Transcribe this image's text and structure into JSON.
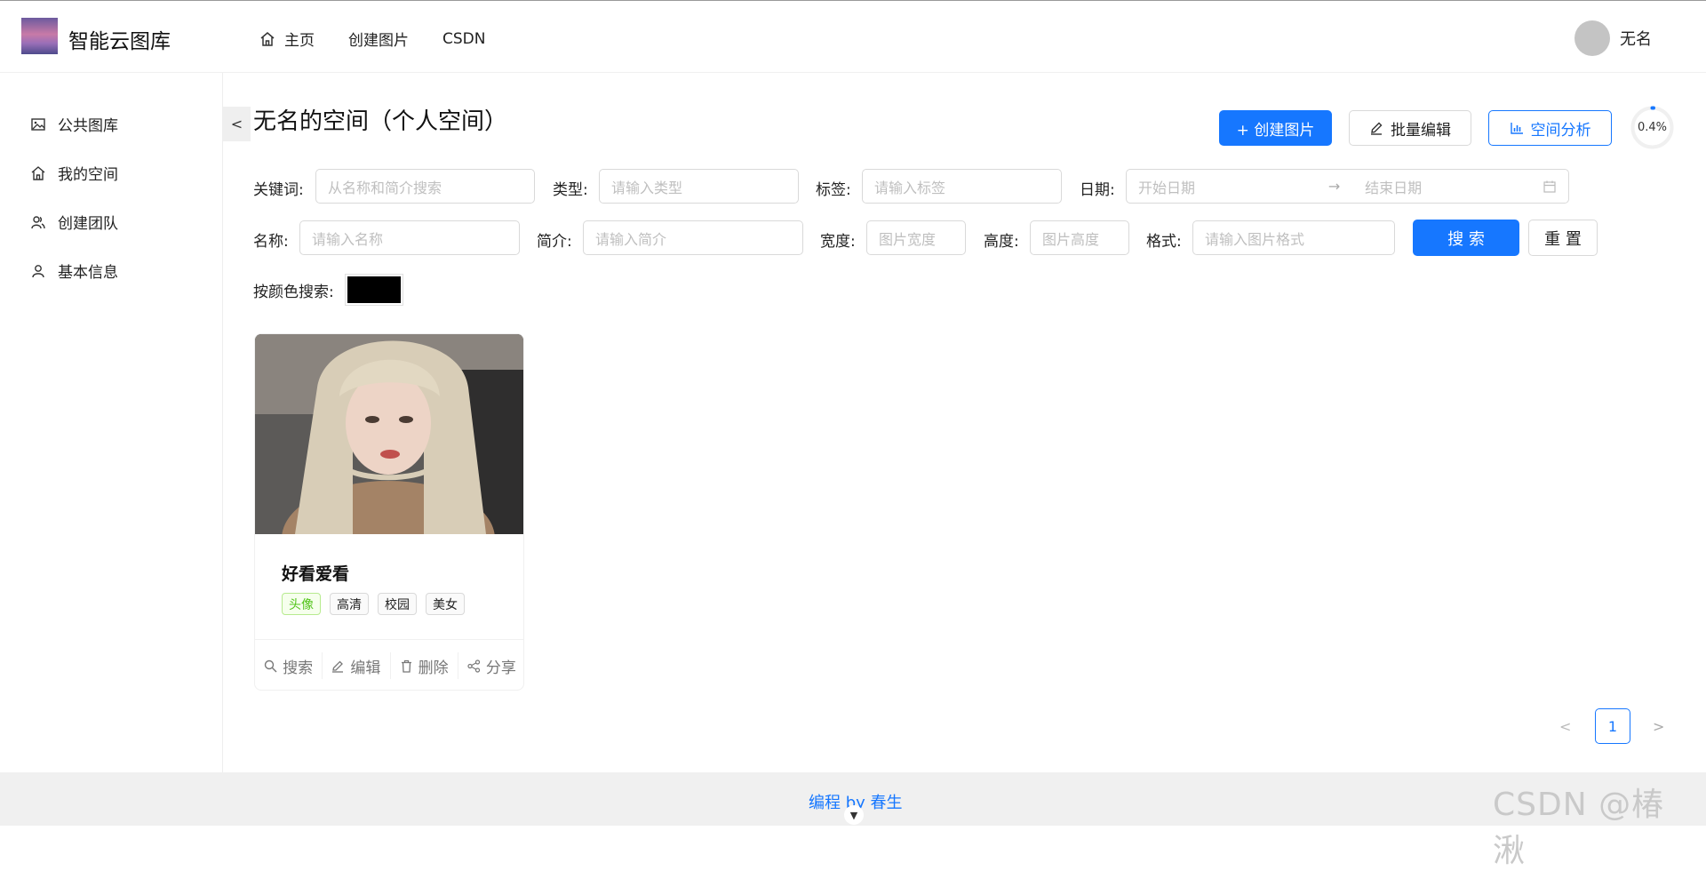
{
  "header": {
    "logo_text": "智能云图库",
    "nav": [
      {
        "label": "主页",
        "icon": "home-icon"
      },
      {
        "label": "创建图片"
      },
      {
        "label": "CSDN"
      }
    ],
    "user_name": "无名"
  },
  "sidebar": {
    "items": [
      {
        "label": "公共图库",
        "icon": "picture-icon"
      },
      {
        "label": "我的空间",
        "icon": "home-icon"
      },
      {
        "label": "创建团队",
        "icon": "team-icon"
      },
      {
        "label": "基本信息",
        "icon": "user-icon"
      }
    ],
    "collapse_label": "<"
  },
  "main": {
    "title": "无名的空间（个人空间）",
    "create_button": "+ 创建图片",
    "batch_edit_button": "批量编辑",
    "analysis_button": "空间分析",
    "usage_percent_text": "0.4%",
    "usage_fraction": 0.004
  },
  "filters": {
    "keyword_label": "关键词:",
    "keyword_placeholder": "从名称和简介搜索",
    "type_label": "类型:",
    "type_placeholder": "请输入类型",
    "tag_label": "标签:",
    "tag_placeholder": "请输入标签",
    "date_label": "日期:",
    "date_start_placeholder": "开始日期",
    "date_arrow": "→",
    "date_end_placeholder": "结束日期",
    "name_label": "名称:",
    "name_placeholder": "请输入名称",
    "intro_label": "简介:",
    "intro_placeholder": "请输入简介",
    "width_label": "宽度:",
    "width_placeholder": "图片宽度",
    "height_label": "高度:",
    "height_placeholder": "图片高度",
    "format_label": "格式:",
    "format_placeholder": "请输入图片格式",
    "search_button": "搜 索",
    "reset_button": "重 置",
    "color_label": "按颜色搜索:",
    "color_value": "#000000"
  },
  "cards": [
    {
      "title": "好看爱看",
      "tags": [
        {
          "label": "头像",
          "style": "green"
        },
        {
          "label": "高清"
        },
        {
          "label": "校园"
        },
        {
          "label": "美女"
        }
      ],
      "actions": [
        {
          "label": "搜索",
          "icon": "search-icon"
        },
        {
          "label": "编辑",
          "icon": "edit-icon"
        },
        {
          "label": "删除",
          "icon": "delete-icon"
        },
        {
          "label": "分享",
          "icon": "share-icon"
        }
      ]
    }
  ],
  "pagination": {
    "current": "1",
    "prev": "<",
    "next": ">"
  },
  "footer": {
    "text": "编程 by 春生"
  },
  "watermark": "CSDN @椿  湫",
  "colors": {
    "primary": "#1677ff",
    "tag_green": "#52c41a"
  }
}
